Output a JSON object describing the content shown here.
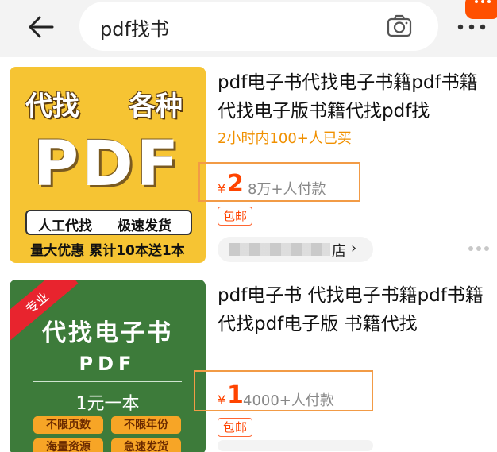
{
  "search": {
    "query": "pdf找书"
  },
  "products": [
    {
      "title": "pdf电子书代找电子书籍pdf书籍代找电子版书籍代找pdf找",
      "sales_note": "2小时内100+人已买",
      "currency": "¥",
      "price": "2",
      "paid_count": "8万+人付款",
      "tag": "包邮",
      "shop_suffix": "店",
      "shop_arrow": "›",
      "thumb": {
        "top_left": "代找",
        "top_right": "各种",
        "big": "PDF",
        "bar_left": "人工代找",
        "bar_right": "极速发货",
        "bottom": "量大优惠 累计10本送1本"
      }
    },
    {
      "title": "pdf电子书 代找电子书籍pdf书籍代找pdf电子版 书籍代找",
      "currency": "¥",
      "price": "1",
      "paid_count": "4000+人付款",
      "tag": "包邮",
      "thumb": {
        "ribbon": "专业",
        "title": "代找电子书",
        "big": "PDF",
        "price": "1元一本",
        "tags": [
          "不限页数",
          "不限年份",
          "海量资源",
          "急速发货"
        ]
      }
    }
  ],
  "colors": {
    "accent": "#ff4400",
    "sales": "#f09000",
    "highlight_box": "#f29b46",
    "badge": "#ff5000"
  }
}
